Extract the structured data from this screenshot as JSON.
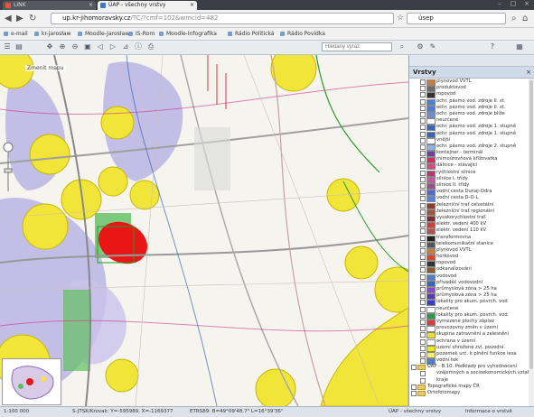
{
  "browser": {
    "tabs": [
      {
        "label": "LINK",
        "active": false
      },
      {
        "label": "ÚAP - všechny vrstvy",
        "active": true
      }
    ],
    "url_host": "up.kr-jihomoravsky.cz",
    "url_path": "/TC/?cmf=102&wmcid=482",
    "search_value": "úsep",
    "bookmarks": [
      "e-mail",
      "kr-jarosław",
      "Moodle-Jarosław",
      "IS-Rom",
      "Moodle-Infografika",
      "Rádio Politická",
      "Rádio Povídka"
    ]
  },
  "toolbar": {
    "map_search_placeholder": "Hledaný výraz"
  },
  "map": {
    "minimap_label": "Zmenit mapu"
  },
  "panel": {
    "title": "Vrstvy",
    "close_icon": "close-icon",
    "layers": [
      {
        "label": "plynovod VVTL",
        "color": "#c87b3a",
        "folder": false
      },
      {
        "label": "produktovod",
        "color": "#6b6b6b",
        "folder": false
      },
      {
        "label": "ropovod",
        "color": "#333333",
        "folder": false
      },
      {
        "label": "ochr. pásmo vod. zdroje II. st.",
        "color": "#4f7fd0",
        "folder": false
      },
      {
        "label": "ochr. pásmo vod. zdroje II. st.",
        "color": "#4f7fd0",
        "folder": false
      },
      {
        "label": "ochr. pásmo vod. zdroje blíže",
        "color": "#6b8fd9",
        "folder": false
      },
      {
        "label": "neurčené",
        "color": "#ffffff",
        "folder": false
      },
      {
        "label": "ochr. pásmo vod. zdroje 1. stupně",
        "color": "#3a64b8",
        "folder": false
      },
      {
        "label": "ochr. pásmo vod. zdroje 1. stupně",
        "color": "#3a64b8",
        "folder": false
      },
      {
        "label": "vnější",
        "color": "#ffffff",
        "folder": false
      },
      {
        "label": "ochr. pásmo vod. zdroje 2. stupně",
        "color": "#8fb1ea",
        "folder": false
      },
      {
        "label": "kontejner - terminál",
        "color": "#6d3fa0",
        "folder": false
      },
      {
        "label": "mimoúrovňová křižovatka",
        "color": "#cc2f5a",
        "folder": false
      },
      {
        "label": "dálnice - stávající",
        "color": "#d04a84",
        "folder": false
      },
      {
        "label": "rychlostní silnice",
        "color": "#b03970",
        "folder": false
      },
      {
        "label": "silnice I. třídy",
        "color": "#c45a9a",
        "folder": false
      },
      {
        "label": "silnice II. třídy",
        "color": "#9a4f8a",
        "folder": false
      },
      {
        "label": "vodní cesta Dunaj-Odra",
        "color": "#4a6fd0",
        "folder": false
      },
      {
        "label": "vodní cesta D-O-L",
        "color": "#5a80e0",
        "folder": false
      },
      {
        "label": "železniční trať celostátní",
        "color": "#8d3f2a",
        "folder": false
      },
      {
        "label": "železniční trať regionální",
        "color": "#a3543c",
        "folder": false
      },
      {
        "label": "vysokorychlostní trať",
        "color": "#7a2f2f",
        "folder": false
      },
      {
        "label": "elektr. vedení 400 kV",
        "color": "#d23c3c",
        "folder": false
      },
      {
        "label": "elektr. vedení 110 kV",
        "color": "#b85050",
        "folder": false
      },
      {
        "label": "transformovna",
        "color": "#222222",
        "folder": false
      },
      {
        "label": "telekomunikační stanice",
        "color": "#555555",
        "folder": false
      },
      {
        "label": "plynovod VVTL",
        "color": "#c87b3a",
        "folder": false
      },
      {
        "label": "horkovod",
        "color": "#d4492e",
        "folder": false
      },
      {
        "label": "ropovod",
        "color": "#333333",
        "folder": false
      },
      {
        "label": "odkanalizování",
        "color": "#8a5a2a",
        "folder": false
      },
      {
        "label": "vodovod",
        "color": "#4f7fd0",
        "folder": false
      },
      {
        "label": "přivaděč vodovodní",
        "color": "#3a64b8",
        "folder": false
      },
      {
        "label": "průmyslová zóna > 25 ha",
        "color": "#8a4ad0",
        "folder": false
      },
      {
        "label": "průmyslová zóna > 25 ha",
        "color": "#5a3ab0",
        "folder": false
      },
      {
        "label": "lokality pro akum. povrch. vod",
        "color": "#3a3ad0",
        "folder": false
      },
      {
        "label": "neurčené",
        "color": "#ffffff",
        "folder": false
      },
      {
        "label": "lokality pro akum. povrch. vod",
        "color": "#2a9a4a",
        "folder": false
      },
      {
        "label": "vymezené plochy záplav",
        "color": "#e03a3a",
        "folder": false
      },
      {
        "label": "provozovny změn v území",
        "color": "#ffffff",
        "folder": false
      },
      {
        "label": "skupina zatravnění a zalesnění",
        "color": "#e8e030",
        "folder": false
      },
      {
        "label": "ochrana v území",
        "color": "#ffffff",
        "folder": false
      },
      {
        "label": "území ohrožené zvl. povodní",
        "color": "#f0ea00",
        "folder": false
      },
      {
        "label": "pozemek urč. k plnění funkce lesa",
        "color": "#f3ef6a",
        "folder": false
      },
      {
        "label": "vodní tok",
        "color": "#4f7fd0",
        "folder": false
      },
      {
        "label": "ÚAP - B.10. Podklady pro vyhodnocení",
        "color": "#e8c96a",
        "folder": true
      },
      {
        "label": "vzájemných a socioekonomických vztahů",
        "color": "",
        "folder": false
      },
      {
        "label": "kraje",
        "color": "",
        "folder": false
      },
      {
        "label": "Topografické mapy ČR",
        "color": "#e8c96a",
        "folder": true
      },
      {
        "label": "Ortofotomapy",
        "color": "#e8c96a",
        "folder": true
      }
    ]
  },
  "status": {
    "scale": "1:100 000",
    "coords": "S-JTSK/Krovak: Y=-595989, X=-1169377",
    "wgs": "ETRS89: B=49°09'48.7\" L=16°39'36\"",
    "title": "ÚAP - všechny vrstvy",
    "info": "Informace o vrstvě"
  }
}
